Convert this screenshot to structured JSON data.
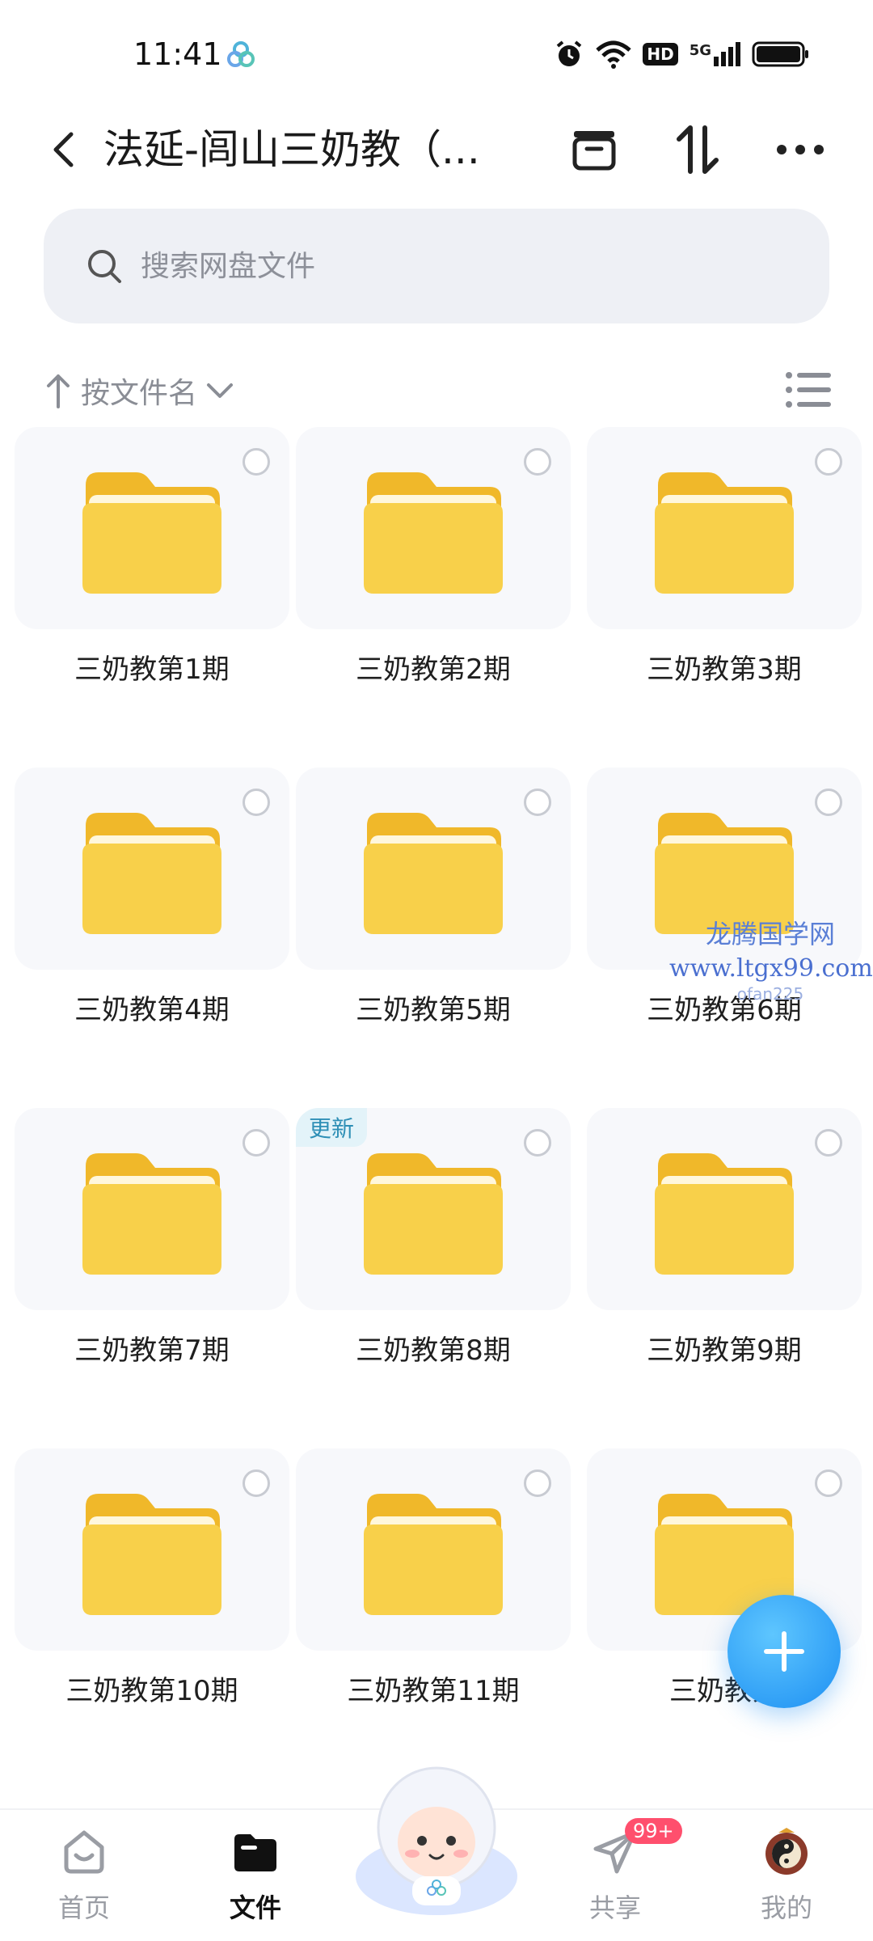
{
  "status_bar": {
    "time": "11:41",
    "network": "5G",
    "hd": "HD"
  },
  "header": {
    "title": "法延-闾山三奶教（..."
  },
  "search": {
    "placeholder": "搜索网盘文件"
  },
  "sort": {
    "label": "按文件名"
  },
  "folders": [
    {
      "name": "三奶教第1期",
      "badge": ""
    },
    {
      "name": "三奶教第2期",
      "badge": ""
    },
    {
      "name": "三奶教第3期",
      "badge": ""
    },
    {
      "name": "三奶教第4期",
      "badge": ""
    },
    {
      "name": "三奶教第5期",
      "badge": ""
    },
    {
      "name": "三奶教第6期",
      "badge": ""
    },
    {
      "name": "三奶教第7期",
      "badge": ""
    },
    {
      "name": "三奶教第8期",
      "badge": "更新"
    },
    {
      "name": "三奶教第9期",
      "badge": ""
    },
    {
      "name": "三奶教第10期",
      "badge": ""
    },
    {
      "name": "三奶教第11期",
      "badge": ""
    },
    {
      "name": "三奶教第",
      "badge": ""
    }
  ],
  "watermark": {
    "title": "龙腾国学网",
    "url": "www.ltgx99.com",
    "sub": "ofan225"
  },
  "bottom_nav": {
    "home": "首页",
    "files": "文件",
    "share": "共享",
    "share_badge": "99+",
    "mine": "我的"
  },
  "colors": {
    "folder": "#f7c93a",
    "accent": "#1d8ff2",
    "badge_bg": "#e3f3f9",
    "badge_text": "#2e8fb6"
  }
}
